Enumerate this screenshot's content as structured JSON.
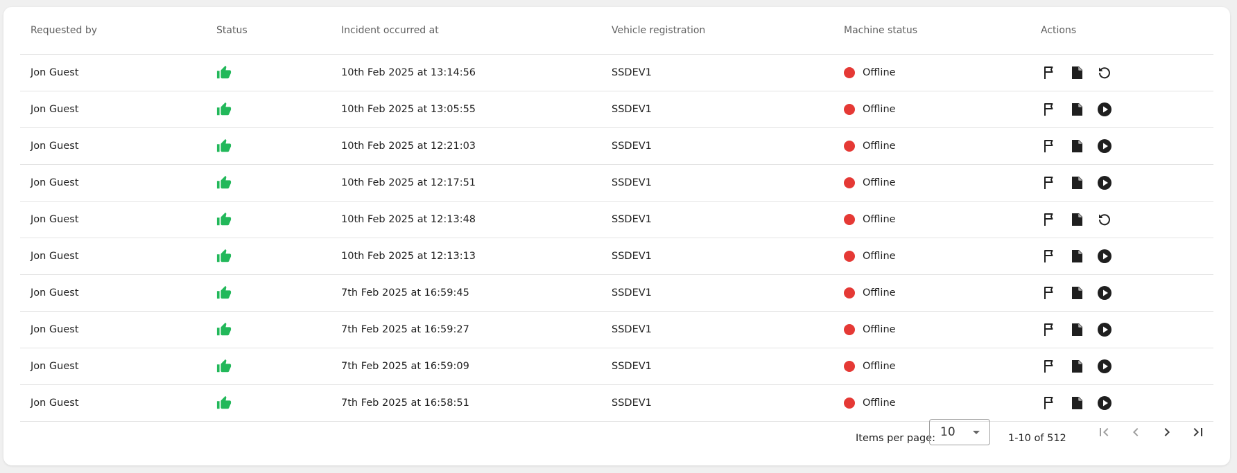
{
  "table": {
    "headers": {
      "requested_by": "Requested by",
      "status": "Status",
      "incident_at": "Incident occurred at",
      "vehicle": "Vehicle registration",
      "machine_status": "Machine status",
      "actions": "Actions"
    },
    "rows": [
      {
        "requested_by": "Jon Guest",
        "status_icon": "thumbs-up-icon",
        "incident_at": "10th Feb 2025 at 13:14:56",
        "vehicle": "SSDEV1",
        "machine_status": "Offline",
        "third_action": "retry-icon"
      },
      {
        "requested_by": "Jon Guest",
        "status_icon": "thumbs-up-icon",
        "incident_at": "10th Feb 2025 at 13:05:55",
        "vehicle": "SSDEV1",
        "machine_status": "Offline",
        "third_action": "play-icon"
      },
      {
        "requested_by": "Jon Guest",
        "status_icon": "thumbs-up-icon",
        "incident_at": "10th Feb 2025 at 12:21:03",
        "vehicle": "SSDEV1",
        "machine_status": "Offline",
        "third_action": "play-icon"
      },
      {
        "requested_by": "Jon Guest",
        "status_icon": "thumbs-up-icon",
        "incident_at": "10th Feb 2025 at 12:17:51",
        "vehicle": "SSDEV1",
        "machine_status": "Offline",
        "third_action": "play-icon"
      },
      {
        "requested_by": "Jon Guest",
        "status_icon": "thumbs-up-icon",
        "incident_at": "10th Feb 2025 at 12:13:48",
        "vehicle": "SSDEV1",
        "machine_status": "Offline",
        "third_action": "retry-icon"
      },
      {
        "requested_by": "Jon Guest",
        "status_icon": "thumbs-up-icon",
        "incident_at": "10th Feb 2025 at 12:13:13",
        "vehicle": "SSDEV1",
        "machine_status": "Offline",
        "third_action": "play-icon"
      },
      {
        "requested_by": "Jon Guest",
        "status_icon": "thumbs-up-icon",
        "incident_at": "7th Feb 2025 at 16:59:45",
        "vehicle": "SSDEV1",
        "machine_status": "Offline",
        "third_action": "play-icon"
      },
      {
        "requested_by": "Jon Guest",
        "status_icon": "thumbs-up-icon",
        "incident_at": "7th Feb 2025 at 16:59:27",
        "vehicle": "SSDEV1",
        "machine_status": "Offline",
        "third_action": "play-icon"
      },
      {
        "requested_by": "Jon Guest",
        "status_icon": "thumbs-up-icon",
        "incident_at": "7th Feb 2025 at 16:59:09",
        "vehicle": "SSDEV1",
        "machine_status": "Offline",
        "third_action": "play-icon"
      },
      {
        "requested_by": "Jon Guest",
        "status_icon": "thumbs-up-icon",
        "incident_at": "7th Feb 2025 at 16:58:51",
        "vehicle": "SSDEV1",
        "machine_status": "Offline",
        "third_action": "play-icon"
      }
    ]
  },
  "pagination": {
    "items_per_page_label": "Items per page:",
    "items_per_page_value": "10",
    "range_label": "1-10 of 512",
    "first_icon": "first-page-icon",
    "prev_icon": "chevron-left-icon",
    "next_icon": "chevron-right-icon",
    "last_icon": "last-page-icon"
  },
  "colors": {
    "status_ok": "#22b85a",
    "offline_dot": "#e53935",
    "icon_dark": "#1f1f1f",
    "pager_disabled": "#9e9e9e"
  }
}
